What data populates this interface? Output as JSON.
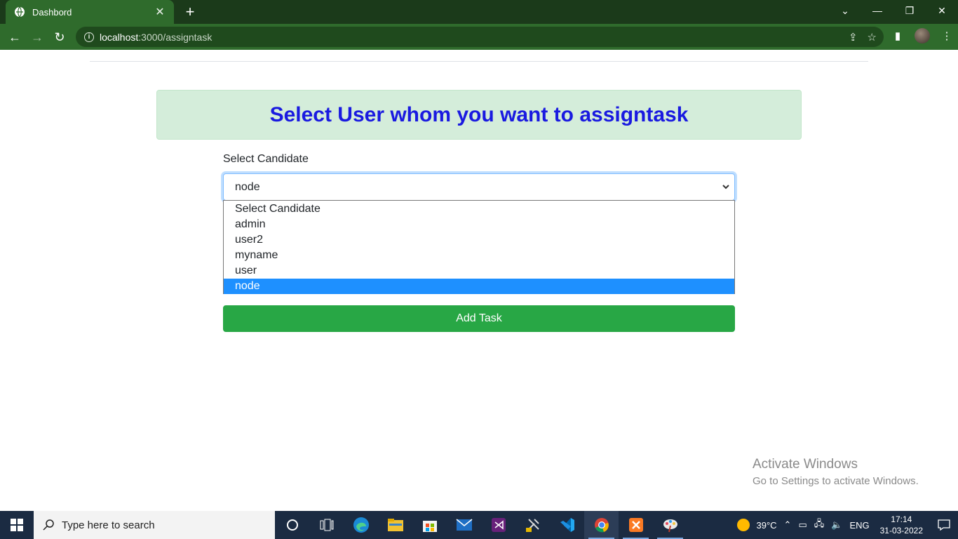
{
  "browser": {
    "tab_title": "Dashbord",
    "url_host": "localhost",
    "url_path": ":3000/assigntask"
  },
  "page": {
    "heading": "Select User whom you want to assigntask",
    "select_label": "Select Candidate",
    "selected_value": "node",
    "options": [
      "Select Candidate",
      "admin",
      "user2",
      "myname",
      "user",
      "node"
    ],
    "add_button": "Add Task"
  },
  "watermark": {
    "line1": "Activate Windows",
    "line2": "Go to Settings to activate Windows."
  },
  "taskbar": {
    "search_placeholder": "Type here to search",
    "temperature": "39°C",
    "language": "ENG",
    "time": "17:14",
    "date": "31-03-2022"
  },
  "colors": {
    "chrome": "#2f6b2c",
    "heading": "#1a1ae0",
    "alert_bg": "#d4edda",
    "button": "#28a745",
    "option_selected": "#1e90ff"
  }
}
